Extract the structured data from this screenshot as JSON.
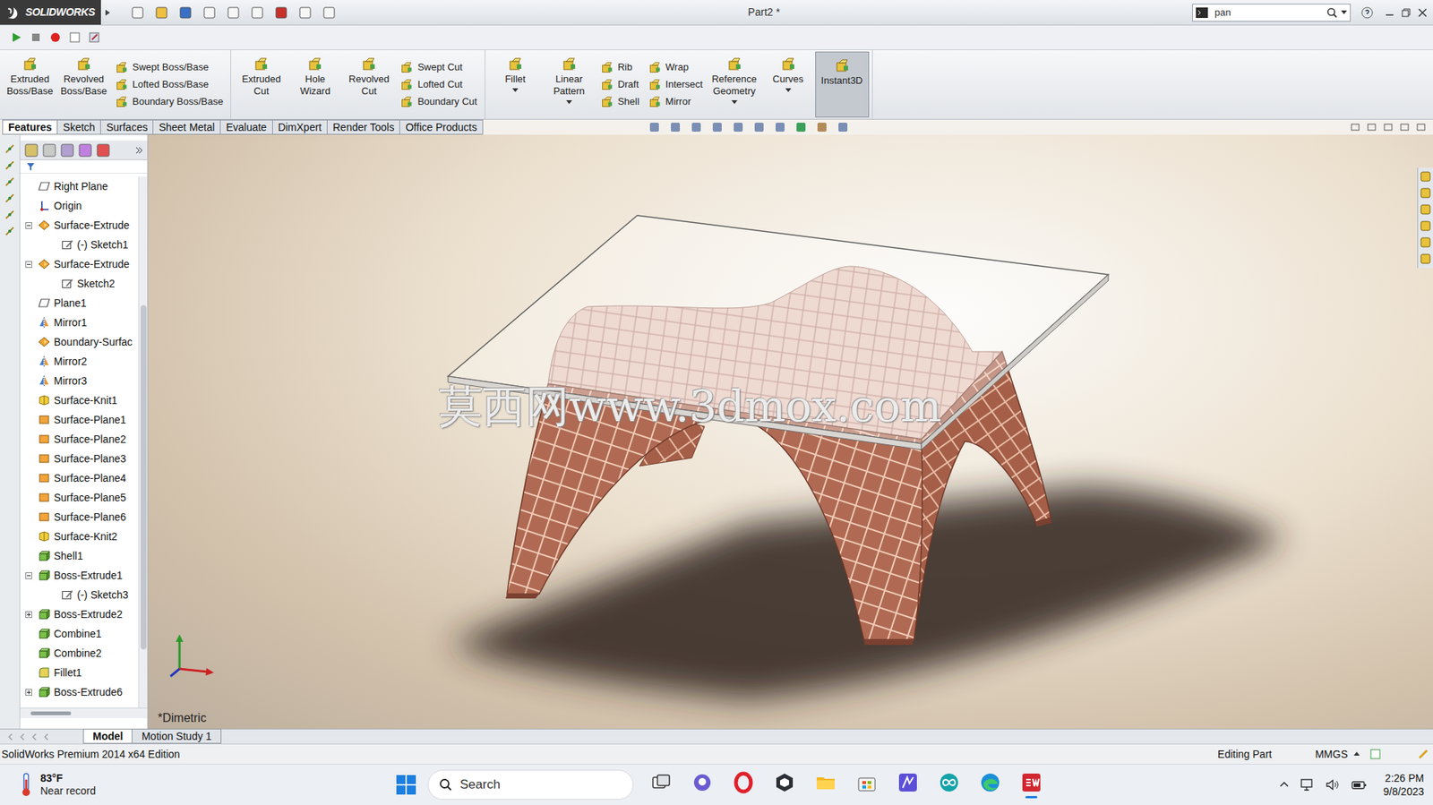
{
  "window": {
    "app": "SOLIDWORKS",
    "title": "Part2 *",
    "search": {
      "value": "pan"
    }
  },
  "command_groups": [
    [
      {
        "kind": "large",
        "label": "Extruded Boss/Base",
        "dropdown": false,
        "selected": false
      },
      {
        "kind": "large",
        "label": "Revolved Boss/Base",
        "dropdown": false,
        "selected": false
      },
      {
        "kind": "stack",
        "items": [
          "Swept Boss/Base",
          "Lofted Boss/Base",
          "Boundary Boss/Base"
        ]
      }
    ],
    [
      {
        "kind": "large",
        "label": "Extruded Cut",
        "dropdown": false,
        "selected": false
      },
      {
        "kind": "large",
        "label": "Hole Wizard",
        "dropdown": false,
        "selected": false
      },
      {
        "kind": "large",
        "label": "Revolved Cut",
        "dropdown": false,
        "selected": false
      },
      {
        "kind": "stack",
        "items": [
          "Swept Cut",
          "Lofted Cut",
          "Boundary Cut"
        ]
      }
    ],
    [
      {
        "kind": "large",
        "label": "Fillet",
        "dropdown": true,
        "selected": false
      },
      {
        "kind": "large",
        "label": "Linear Pattern",
        "dropdown": true,
        "selected": false
      },
      {
        "kind": "stack",
        "items": [
          "Rib",
          "Draft",
          "Shell"
        ]
      },
      {
        "kind": "stack",
        "items": [
          "Wrap",
          "Intersect",
          "Mirror"
        ]
      },
      {
        "kind": "large",
        "label": "Reference Geometry",
        "dropdown": true,
        "selected": false
      },
      {
        "kind": "large",
        "label": "Curves",
        "dropdown": true,
        "selected": false
      },
      {
        "kind": "large",
        "label": "Instant3D",
        "dropdown": false,
        "selected": true
      }
    ]
  ],
  "tabs": [
    {
      "label": "Features",
      "selected": true
    },
    {
      "label": "Sketch",
      "selected": false
    },
    {
      "label": "Surfaces",
      "selected": false
    },
    {
      "label": "Sheet Metal",
      "selected": false
    },
    {
      "label": "Evaluate",
      "selected": false
    },
    {
      "label": "DimXpert",
      "selected": false
    },
    {
      "label": "Render Tools",
      "selected": false
    },
    {
      "label": "Office Products",
      "selected": false
    }
  ],
  "feature_tree": {
    "items": [
      {
        "label": "Right Plane",
        "kind": "plane",
        "level": 0,
        "toggle": false,
        "expanded": false
      },
      {
        "label": "Origin",
        "kind": "origin",
        "level": 0,
        "toggle": false,
        "expanded": false
      },
      {
        "label": "Surface-Extrude",
        "kind": "surface",
        "level": 0,
        "toggle": true,
        "expanded": true
      },
      {
        "label": "(-) Sketch1",
        "kind": "sketch",
        "level": 1,
        "toggle": false,
        "expanded": false
      },
      {
        "label": "Surface-Extrude",
        "kind": "surface",
        "level": 0,
        "toggle": true,
        "expanded": true
      },
      {
        "label": "Sketch2",
        "kind": "sketch",
        "level": 1,
        "toggle": false,
        "expanded": false
      },
      {
        "label": "Plane1",
        "kind": "plane",
        "level": 0,
        "toggle": false,
        "expanded": false
      },
      {
        "label": "Mirror1",
        "kind": "mirror",
        "level": 0,
        "toggle": false,
        "expanded": false
      },
      {
        "label": "Boundary-Surfac",
        "kind": "surface",
        "level": 0,
        "toggle": false,
        "expanded": false
      },
      {
        "label": "Mirror2",
        "kind": "mirror",
        "level": 0,
        "toggle": false,
        "expanded": false
      },
      {
        "label": "Mirror3",
        "kind": "mirror",
        "level": 0,
        "toggle": false,
        "expanded": false
      },
      {
        "label": "Surface-Knit1",
        "kind": "knit",
        "level": 0,
        "toggle": false,
        "expanded": false
      },
      {
        "label": "Surface-Plane1",
        "kind": "surfplane",
        "level": 0,
        "toggle": false,
        "expanded": false
      },
      {
        "label": "Surface-Plane2",
        "kind": "surfplane",
        "level": 0,
        "toggle": false,
        "expanded": false
      },
      {
        "label": "Surface-Plane3",
        "kind": "surfplane",
        "level": 0,
        "toggle": false,
        "expanded": false
      },
      {
        "label": "Surface-Plane4",
        "kind": "surfplane",
        "level": 0,
        "toggle": false,
        "expanded": false
      },
      {
        "label": "Surface-Plane5",
        "kind": "surfplane",
        "level": 0,
        "toggle": false,
        "expanded": false
      },
      {
        "label": "Surface-Plane6",
        "kind": "surfplane",
        "level": 0,
        "toggle": false,
        "expanded": false
      },
      {
        "label": "Surface-Knit2",
        "kind": "knit",
        "level": 0,
        "toggle": false,
        "expanded": false
      },
      {
        "label": "Shell1",
        "kind": "solid",
        "level": 0,
        "toggle": false,
        "expanded": false
      },
      {
        "label": "Boss-Extrude1",
        "kind": "solid",
        "level": 0,
        "toggle": true,
        "expanded": true
      },
      {
        "label": "(-) Sketch3",
        "kind": "sketch",
        "level": 1,
        "toggle": false,
        "expanded": false
      },
      {
        "label": "Boss-Extrude2",
        "kind": "solid",
        "level": 0,
        "toggle": true,
        "expanded": false
      },
      {
        "label": "Combine1",
        "kind": "solid",
        "level": 0,
        "toggle": false,
        "expanded": false
      },
      {
        "label": "Combine2",
        "kind": "solid",
        "level": 0,
        "toggle": false,
        "expanded": false
      },
      {
        "label": "Fillet1",
        "kind": "fillet",
        "level": 0,
        "toggle": false,
        "expanded": false
      },
      {
        "label": "Boss-Extrude6",
        "kind": "solid",
        "level": 0,
        "toggle": true,
        "expanded": false
      }
    ]
  },
  "viewport": {
    "view_label": "*Dimetric",
    "watermark": "莫西网www.3dmox.com"
  },
  "bottom_tabs": [
    {
      "label": "Model",
      "selected": true
    },
    {
      "label": "Motion Study 1",
      "selected": false
    }
  ],
  "status_bar": {
    "edition": "SolidWorks Premium 2014 x64 Edition",
    "mode": "Editing Part",
    "units": "MMGS"
  },
  "taskbar": {
    "weather": {
      "temp": "83°F",
      "note": "Near record"
    },
    "search": "Search",
    "apps": [
      {
        "kind": "taskview",
        "active": false
      },
      {
        "kind": "chat",
        "active": false
      },
      {
        "kind": "opera",
        "active": false
      },
      {
        "kind": "unity",
        "active": false
      },
      {
        "kind": "explorer",
        "active": false
      },
      {
        "kind": "store",
        "active": false
      },
      {
        "kind": "visual",
        "active": false
      },
      {
        "kind": "arduino",
        "active": false
      },
      {
        "kind": "edge",
        "active": false
      },
      {
        "kind": "solidworks",
        "active": true
      }
    ],
    "time": "2:26 PM",
    "date": "9/8/2023"
  }
}
